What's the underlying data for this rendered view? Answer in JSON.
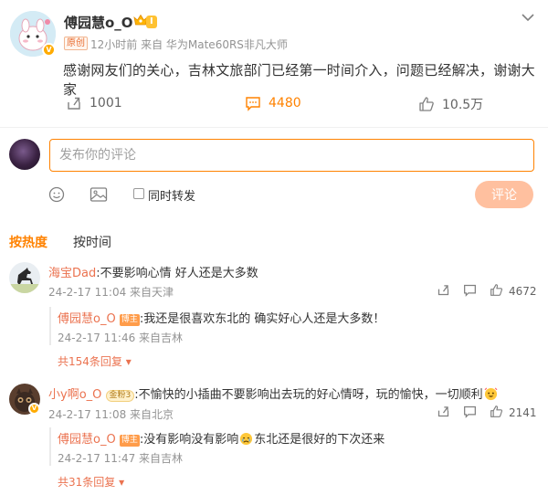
{
  "post": {
    "author": "傅园慧o_O",
    "level": "Ⅰ",
    "original_tag": "原创",
    "meta": "12小时前 来自 华为Mate60RS非凡大师",
    "text": "感谢网友们的关心，吉林文旅部门已经第一时间介入，问题已经解决，谢谢大家",
    "reposts": "1001",
    "comments": "4480",
    "likes": "10.5万"
  },
  "composer": {
    "placeholder": "发布你的评论",
    "repost_label": "同时转发",
    "submit_label": "评论"
  },
  "tabs": {
    "hot": "按热度",
    "time": "按时间"
  },
  "comments": [
    {
      "user": "海宝Dad",
      "text": ":不要影响心情 好人还是大多数",
      "meta": "24-2-17 11:04 来自天津",
      "likes": "4672",
      "reply": {
        "user": "傅园慧o_O",
        "tag": "博主",
        "text": ":我还是很喜欢东北的 确实好心人还是大多数！",
        "meta": "24-2-17 11:46 来自吉林"
      },
      "more": "共154条回复"
    },
    {
      "user": "小y啊o_O",
      "badge": "金粉3",
      "text": ":不愉快的小插曲不要影响出去玩的好心情呀，玩的愉快，一切顺利",
      "meta": "24-2-17 11:08 来自北京",
      "likes": "2141",
      "reply": {
        "user": "傅园慧o_O",
        "tag": "博主",
        "text_a": ":没有影响没有影响",
        "text_b": "东北还是很好的下次还来",
        "meta": "24-2-17 11:47 来自吉林"
      },
      "more": "共31条回复"
    }
  ],
  "colors": {
    "accent": "#ff8200",
    "link": "#eb7350",
    "submit_disabled": "#ffc09f",
    "meta_gray": "#939393"
  }
}
